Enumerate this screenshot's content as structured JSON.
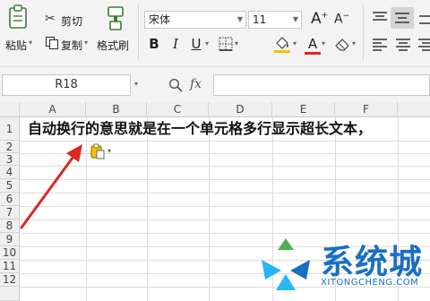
{
  "toolbar": {
    "paste": "粘贴",
    "cut": "剪切",
    "copy": "复制",
    "format_painter": "格式刷",
    "font_name": "宋体",
    "font_size": "11",
    "grow_font": "A",
    "shrink_font": "A",
    "bold": "B",
    "italic": "I",
    "underline": "U",
    "font_color_letter": "A"
  },
  "formula_bar": {
    "name_box": "R18",
    "fx": "fx",
    "value": ""
  },
  "sheet": {
    "columns": [
      "A",
      "B",
      "C",
      "D",
      "E",
      "F"
    ],
    "rows": [
      "1",
      "2",
      "3",
      "4",
      "5",
      "6",
      "7",
      "8",
      "9",
      "10",
      "11",
      "12"
    ],
    "cell_A1": "自动换行的意思就是在一个单元格多行显示超长文本，"
  },
  "watermark": {
    "text": "系统城",
    "url": "XITONGCHENG.COM",
    "colors": [
      "#1a6fc4",
      "#4caf50",
      "#29b6f6"
    ]
  },
  "colors": {
    "arrow": "#e02424",
    "font_color_bar": "#e02424",
    "fill_color_bar": "#f5c400"
  }
}
